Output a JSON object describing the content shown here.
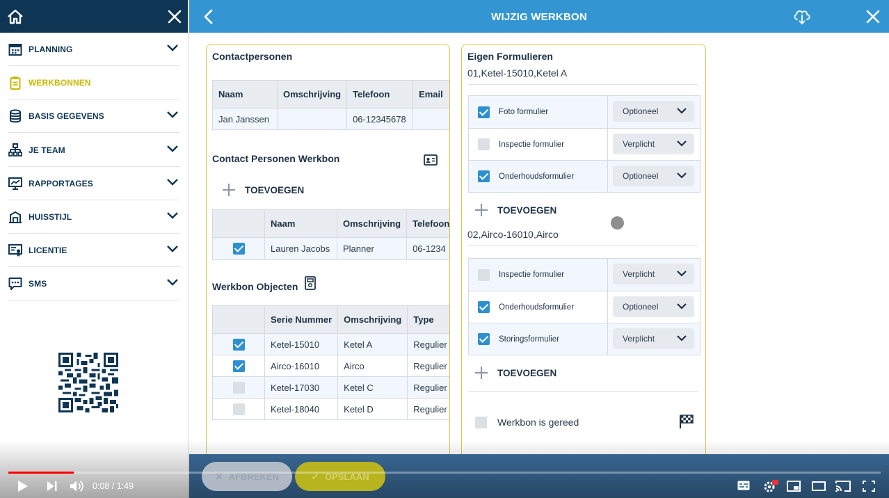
{
  "sidebar": {
    "items": [
      {
        "label": "PLANNING"
      },
      {
        "label": "WERKBONNEN"
      },
      {
        "label": "BASIS GEGEVENS"
      },
      {
        "label": "JE TEAM"
      },
      {
        "label": "RAPPORTAGES"
      },
      {
        "label": "HUISSTIJL"
      },
      {
        "label": "LICENTIE"
      },
      {
        "label": "SMS"
      }
    ]
  },
  "header": {
    "title": "WIJZIG WERKBON"
  },
  "contactpersonen": {
    "title": "Contactpersonen",
    "columns": [
      "Naam",
      "Omschrijving",
      "Telefoon",
      "Email"
    ],
    "rows": [
      [
        "Jan Janssen",
        "",
        "06-12345678",
        ""
      ]
    ]
  },
  "contact_werkbon": {
    "title": "Contact Personen Werkbon",
    "add_label": "TOEVOEGEN",
    "columns": [
      "",
      "Naam",
      "Omschrijving",
      "Telefoon"
    ],
    "rows": [
      {
        "checked": true,
        "naam": "Lauren Jacobs",
        "omschrijving": "Planner",
        "telefoon": "06-1234"
      }
    ]
  },
  "werkbon_objecten": {
    "title": "Werkbon Objecten",
    "columns": [
      "",
      "Serie Nummer",
      "Omschrijving",
      "Type"
    ],
    "rows": [
      {
        "checked": true,
        "serie": "Ketel-15010",
        "omschrijving": "Ketel A",
        "type": "Regulier"
      },
      {
        "checked": true,
        "serie": "Airco-16010",
        "omschrijving": "Airco",
        "type": "Regulier"
      },
      {
        "checked": false,
        "serie": "Ketel-17030",
        "omschrijving": "Ketel C",
        "type": "Regulier"
      },
      {
        "checked": false,
        "serie": "Ketel-18040",
        "omschrijving": "Ketel D",
        "type": "Regulier"
      }
    ]
  },
  "eigen_formulieren": {
    "title": "Eigen Formulieren",
    "groups": [
      {
        "label": "01,Ketel-15010,Ketel A",
        "forms": [
          {
            "checked": true,
            "name": "Foto formulier",
            "status": "Optioneel"
          },
          {
            "checked": false,
            "name": "Inspectie formulier",
            "status": "Verplicht"
          },
          {
            "checked": true,
            "name": "Onderhoudsformulier",
            "status": "Optioneel"
          }
        ]
      },
      {
        "label": "02,Airco-16010,Airco",
        "forms": [
          {
            "checked": false,
            "name": "Inspectie formulier",
            "status": "Verplicht"
          },
          {
            "checked": true,
            "name": "Onderhoudsformulier",
            "status": "Optioneel"
          },
          {
            "checked": true,
            "name": "Storingsformulier",
            "status": "Verplicht"
          }
        ]
      }
    ],
    "add_label": "TOEVOEGEN",
    "gereed_label": "Werkbon is gereed"
  },
  "actions": {
    "cancel": "AFBREKEN",
    "save": "OPSLAAN"
  },
  "video": {
    "time": "0:08 / 1:49",
    "progress": 0.075
  },
  "colors": {
    "header": "#3396d3",
    "sidebar_top": "#0f3554",
    "active": "#c9b800",
    "accent": "#2e8fd1"
  }
}
